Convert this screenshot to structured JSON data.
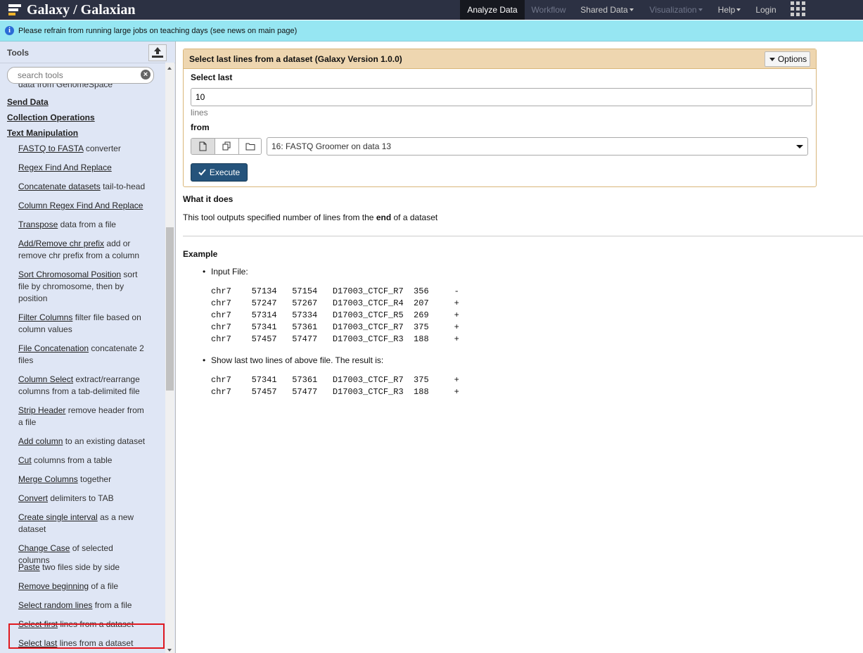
{
  "masthead": {
    "brand": "Galaxy / Galaxian",
    "nav": [
      {
        "label": "Analyze Data",
        "state": "active",
        "caret": false
      },
      {
        "label": "Workflow",
        "state": "disabled",
        "caret": false
      },
      {
        "label": "Shared Data",
        "state": "normal",
        "caret": true
      },
      {
        "label": "Visualization",
        "state": "disabled",
        "caret": true
      },
      {
        "label": "Help",
        "state": "normal",
        "caret": true
      },
      {
        "label": "Login",
        "state": "normal",
        "caret": false
      }
    ],
    "apps_icon": "grid-icon"
  },
  "message": {
    "icon": "info-icon",
    "text": "Please refrain from running large jobs on teaching days (see news on main page)"
  },
  "tool_panel": {
    "title": "Tools",
    "upload_icon": "upload-icon",
    "search_placeholder": "search tools",
    "cut_off_text": "data from GenomeSpace",
    "sections": [
      "Send Data",
      "Collection Operations",
      "Text Manipulation"
    ],
    "tools": [
      {
        "name": "FASTQ to FASTA",
        "desc": " converter"
      },
      {
        "name": "Regex Find And Replace",
        "desc": ""
      },
      {
        "name": "Concatenate datasets",
        "desc": " tail-to-head"
      },
      {
        "name": "Column Regex Find And Replace",
        "desc": ""
      },
      {
        "name": "Transpose",
        "desc": " data from a file"
      },
      {
        "name": "Add/Remove chr prefix",
        "desc": " add or remove chr prefix from a column"
      },
      {
        "name": "Sort Chromosomal Position",
        "desc": " sort file by chromosome, then by position"
      },
      {
        "name": "Filter Columns",
        "desc": " filter file based on column values"
      },
      {
        "name": "File Concatenation",
        "desc": " concatenate 2 files"
      },
      {
        "name": "Column Select",
        "desc": " extract/rearrange columns from a tab-delimited file"
      },
      {
        "name": "Strip Header",
        "desc": " remove header from a file"
      },
      {
        "name": "Add column",
        "desc": " to an existing dataset"
      },
      {
        "name": "Cut",
        "desc": " columns from a table"
      },
      {
        "name": "Merge Columns",
        "desc": " together"
      },
      {
        "name": "Convert",
        "desc": " delimiters to TAB"
      },
      {
        "name": "Create single interval",
        "desc": " as a new dataset"
      },
      {
        "name": "Change Case",
        "desc": " of selected columns"
      },
      {
        "name": "Paste",
        "desc": " two files side by side"
      },
      {
        "name": "Remove beginning",
        "desc": " of a file"
      },
      {
        "name": "Select random lines",
        "desc": " from a file"
      },
      {
        "name": "Select first",
        "desc": " lines from a dataset"
      },
      {
        "name": "Select last",
        "desc": " lines from a dataset"
      }
    ]
  },
  "tool_form": {
    "title": "Select last lines from a dataset (Galaxy Version 1.0.0)",
    "options_label": "Options",
    "select_last_label": "Select last",
    "select_last_value": "10",
    "select_last_help": "lines",
    "from_label": "from",
    "dataset_type_buttons": [
      "single-file-icon",
      "multiple-files-icon",
      "folder-icon"
    ],
    "dataset_value": "16: FASTQ Groomer on data 13",
    "execute_label": "Execute"
  },
  "help": {
    "what_title": "What it does",
    "what_pre": "This tool outputs specified number of lines from the ",
    "what_bold": "end",
    "what_post": " of a dataset",
    "example_title": "Example",
    "bullet1": "Input File:",
    "code1": "chr7    57134   57154   D17003_CTCF_R7  356     -\nchr7    57247   57267   D17003_CTCF_R4  207     +\nchr7    57314   57334   D17003_CTCF_R5  269     +\nchr7    57341   57361   D17003_CTCF_R7  375     +\nchr7    57457   57477   D17003_CTCF_R3  188     +",
    "bullet2": "Show last two lines of above file. The result is:",
    "code2": "chr7    57341   57361   D17003_CTCF_R7  375     +\nchr7    57457   57477   D17003_CTCF_R3  188     +"
  }
}
